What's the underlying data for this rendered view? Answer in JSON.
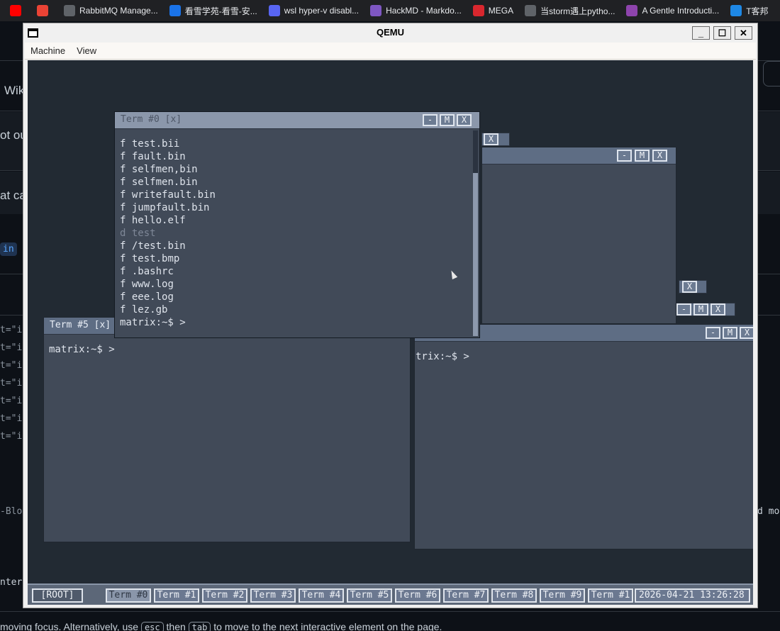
{
  "bookmarks": [
    {
      "label": "",
      "icon": "youtube-icon",
      "color": "#ff0000"
    },
    {
      "label": "",
      "icon": "gmail-icon",
      "color": "#ea4335"
    },
    {
      "label": "RabbitMQ Manage...",
      "icon": "globe-icon",
      "color": "#5f6368"
    },
    {
      "label": "看雪学苑-看雪-安...",
      "icon": "kanxue-icon",
      "color": "#1a73e8"
    },
    {
      "label": "wsl hyper-v disabl...",
      "icon": "bird-icon",
      "color": "#5865f2"
    },
    {
      "label": "HackMD - Markdo...",
      "icon": "hackmd-icon",
      "color": "#7e57c2"
    },
    {
      "label": "MEGA",
      "icon": "mega-icon",
      "color": "#d9272e"
    },
    {
      "label": "当storm遇上pytho...",
      "icon": "globe-icon",
      "color": "#5f6368"
    },
    {
      "label": "A Gentle Introducti...",
      "icon": "shield-icon",
      "color": "#8e44ad"
    },
    {
      "label": "T客邦",
      "icon": "tkb-icon",
      "color": "#1e88e5"
    }
  ],
  "background_page": {
    "fragments": [
      "Wik",
      "ot ou",
      "at ca",
      "in"
    ],
    "code_lines": [
      "t=\"in",
      "t=\"in",
      "t=\"in",
      "t=\"in",
      "t=\"in",
      "t=\"in",
      "t=\"in"
    ],
    "side_text_left": "-Bloc",
    "side_text_right": "d mo",
    "enter_text": "nter",
    "bottom_pre": "moving focus. Alternatively, use",
    "bottom_kbd1": "esc",
    "bottom_mid": "then",
    "bottom_kbd2": "tab",
    "bottom_post": "to move to the next interactive element on the page."
  },
  "qemu": {
    "title": "QEMU",
    "minimize": "_",
    "maximize": "☐",
    "close": "✕",
    "menu": [
      "Machine",
      "View"
    ]
  },
  "term0": {
    "title": "Term #0 [x]",
    "files": [
      {
        "type": "f",
        "name": "test.bii"
      },
      {
        "type": "f",
        "name": "fault.bin"
      },
      {
        "type": "f",
        "name": "selfmen,bin"
      },
      {
        "type": "f",
        "name": "selfmen.bin"
      },
      {
        "type": "f",
        "name": "writefault.bin"
      },
      {
        "type": "f",
        "name": "jumpfault.bin"
      },
      {
        "type": "f",
        "name": "hello.elf"
      },
      {
        "type": "d",
        "name": "test"
      },
      {
        "type": "f",
        "name": "/test.bin"
      },
      {
        "type": "f",
        "name": "test.bmp"
      },
      {
        "type": "f",
        "name": ".bashrc"
      },
      {
        "type": "f",
        "name": "www.log"
      },
      {
        "type": "f",
        "name": "eee.log"
      },
      {
        "type": "f",
        "name": "lez.gb"
      }
    ],
    "prompt": "matrix:~$ >"
  },
  "term5": {
    "title": "Term #5 [x]",
    "prompt": "matrix:~$ >"
  },
  "term_right": {
    "prompt": "trix:~$ >"
  },
  "button_glyphs": {
    "min": "-",
    "max": "M",
    "close": "X"
  },
  "taskbar": {
    "root": "[ROOT]",
    "terms": [
      "Term #0",
      "Term #1",
      "Term #2",
      "Term #3",
      "Term #4",
      "Term #5",
      "Term #6",
      "Term #7",
      "Term #8",
      "Term #9",
      "Term #1"
    ],
    "clock": "2026-04-21 13:26:28"
  }
}
